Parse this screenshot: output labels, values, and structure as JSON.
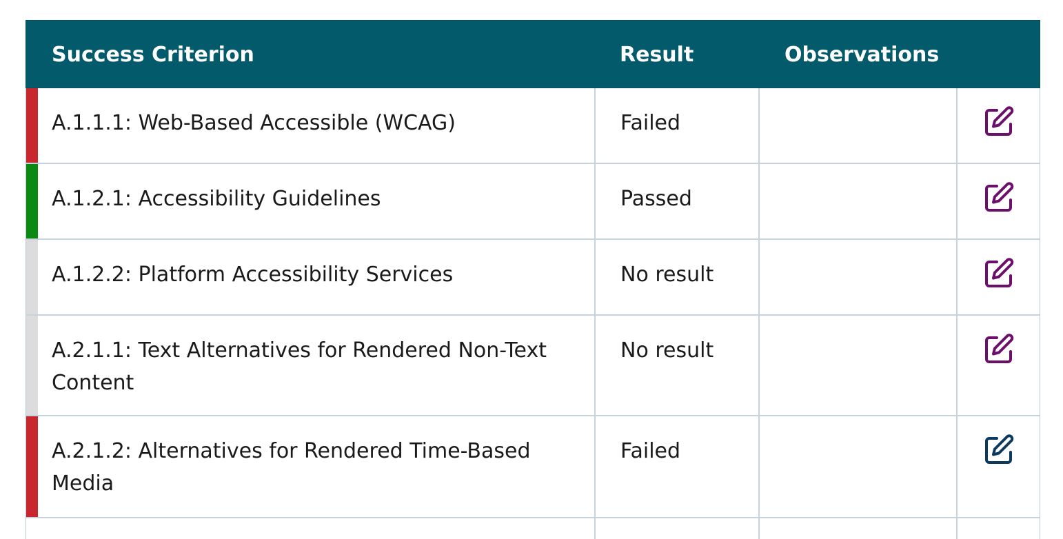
{
  "table": {
    "headers": {
      "criterion": "Success Criterion",
      "result": "Result",
      "observations": "Observations"
    },
    "rows": [
      {
        "criterion": "A.1.1.1: Web-Based Accessible (WCAG)",
        "result": "Failed",
        "observations": "",
        "status_color": "#c8272d",
        "edit_icon": "edit-icon",
        "edit_color": "#6b0f6b"
      },
      {
        "criterion": "A.1.2.1: Accessibility Guidelines",
        "result": "Passed",
        "observations": "",
        "status_color": "#0a8a12",
        "edit_icon": "edit-icon",
        "edit_color": "#6b0f6b"
      },
      {
        "criterion": "A.1.2.2: Platform Accessibility Services",
        "result": "No result",
        "observations": "",
        "status_color": "#dcdcdc",
        "edit_icon": "edit-icon",
        "edit_color": "#6b0f6b"
      },
      {
        "criterion": "A.2.1.1: Text Alternatives for Rendered Non-Text Content",
        "result": "No result",
        "observations": "",
        "status_color": "#dcdcdc",
        "edit_icon": "edit-icon",
        "edit_color": "#6b0f6b"
      },
      {
        "criterion": "A.2.1.2: Alternatives for Rendered Time-Based Media",
        "result": "Failed",
        "observations": "",
        "status_color": "#c8272d",
        "edit_icon": "edit-icon",
        "edit_color": "#0b3a5e"
      }
    ]
  },
  "colors": {
    "header_bg": "#025a6b",
    "header_text": "#ffffff",
    "border": "#c7d3db"
  }
}
